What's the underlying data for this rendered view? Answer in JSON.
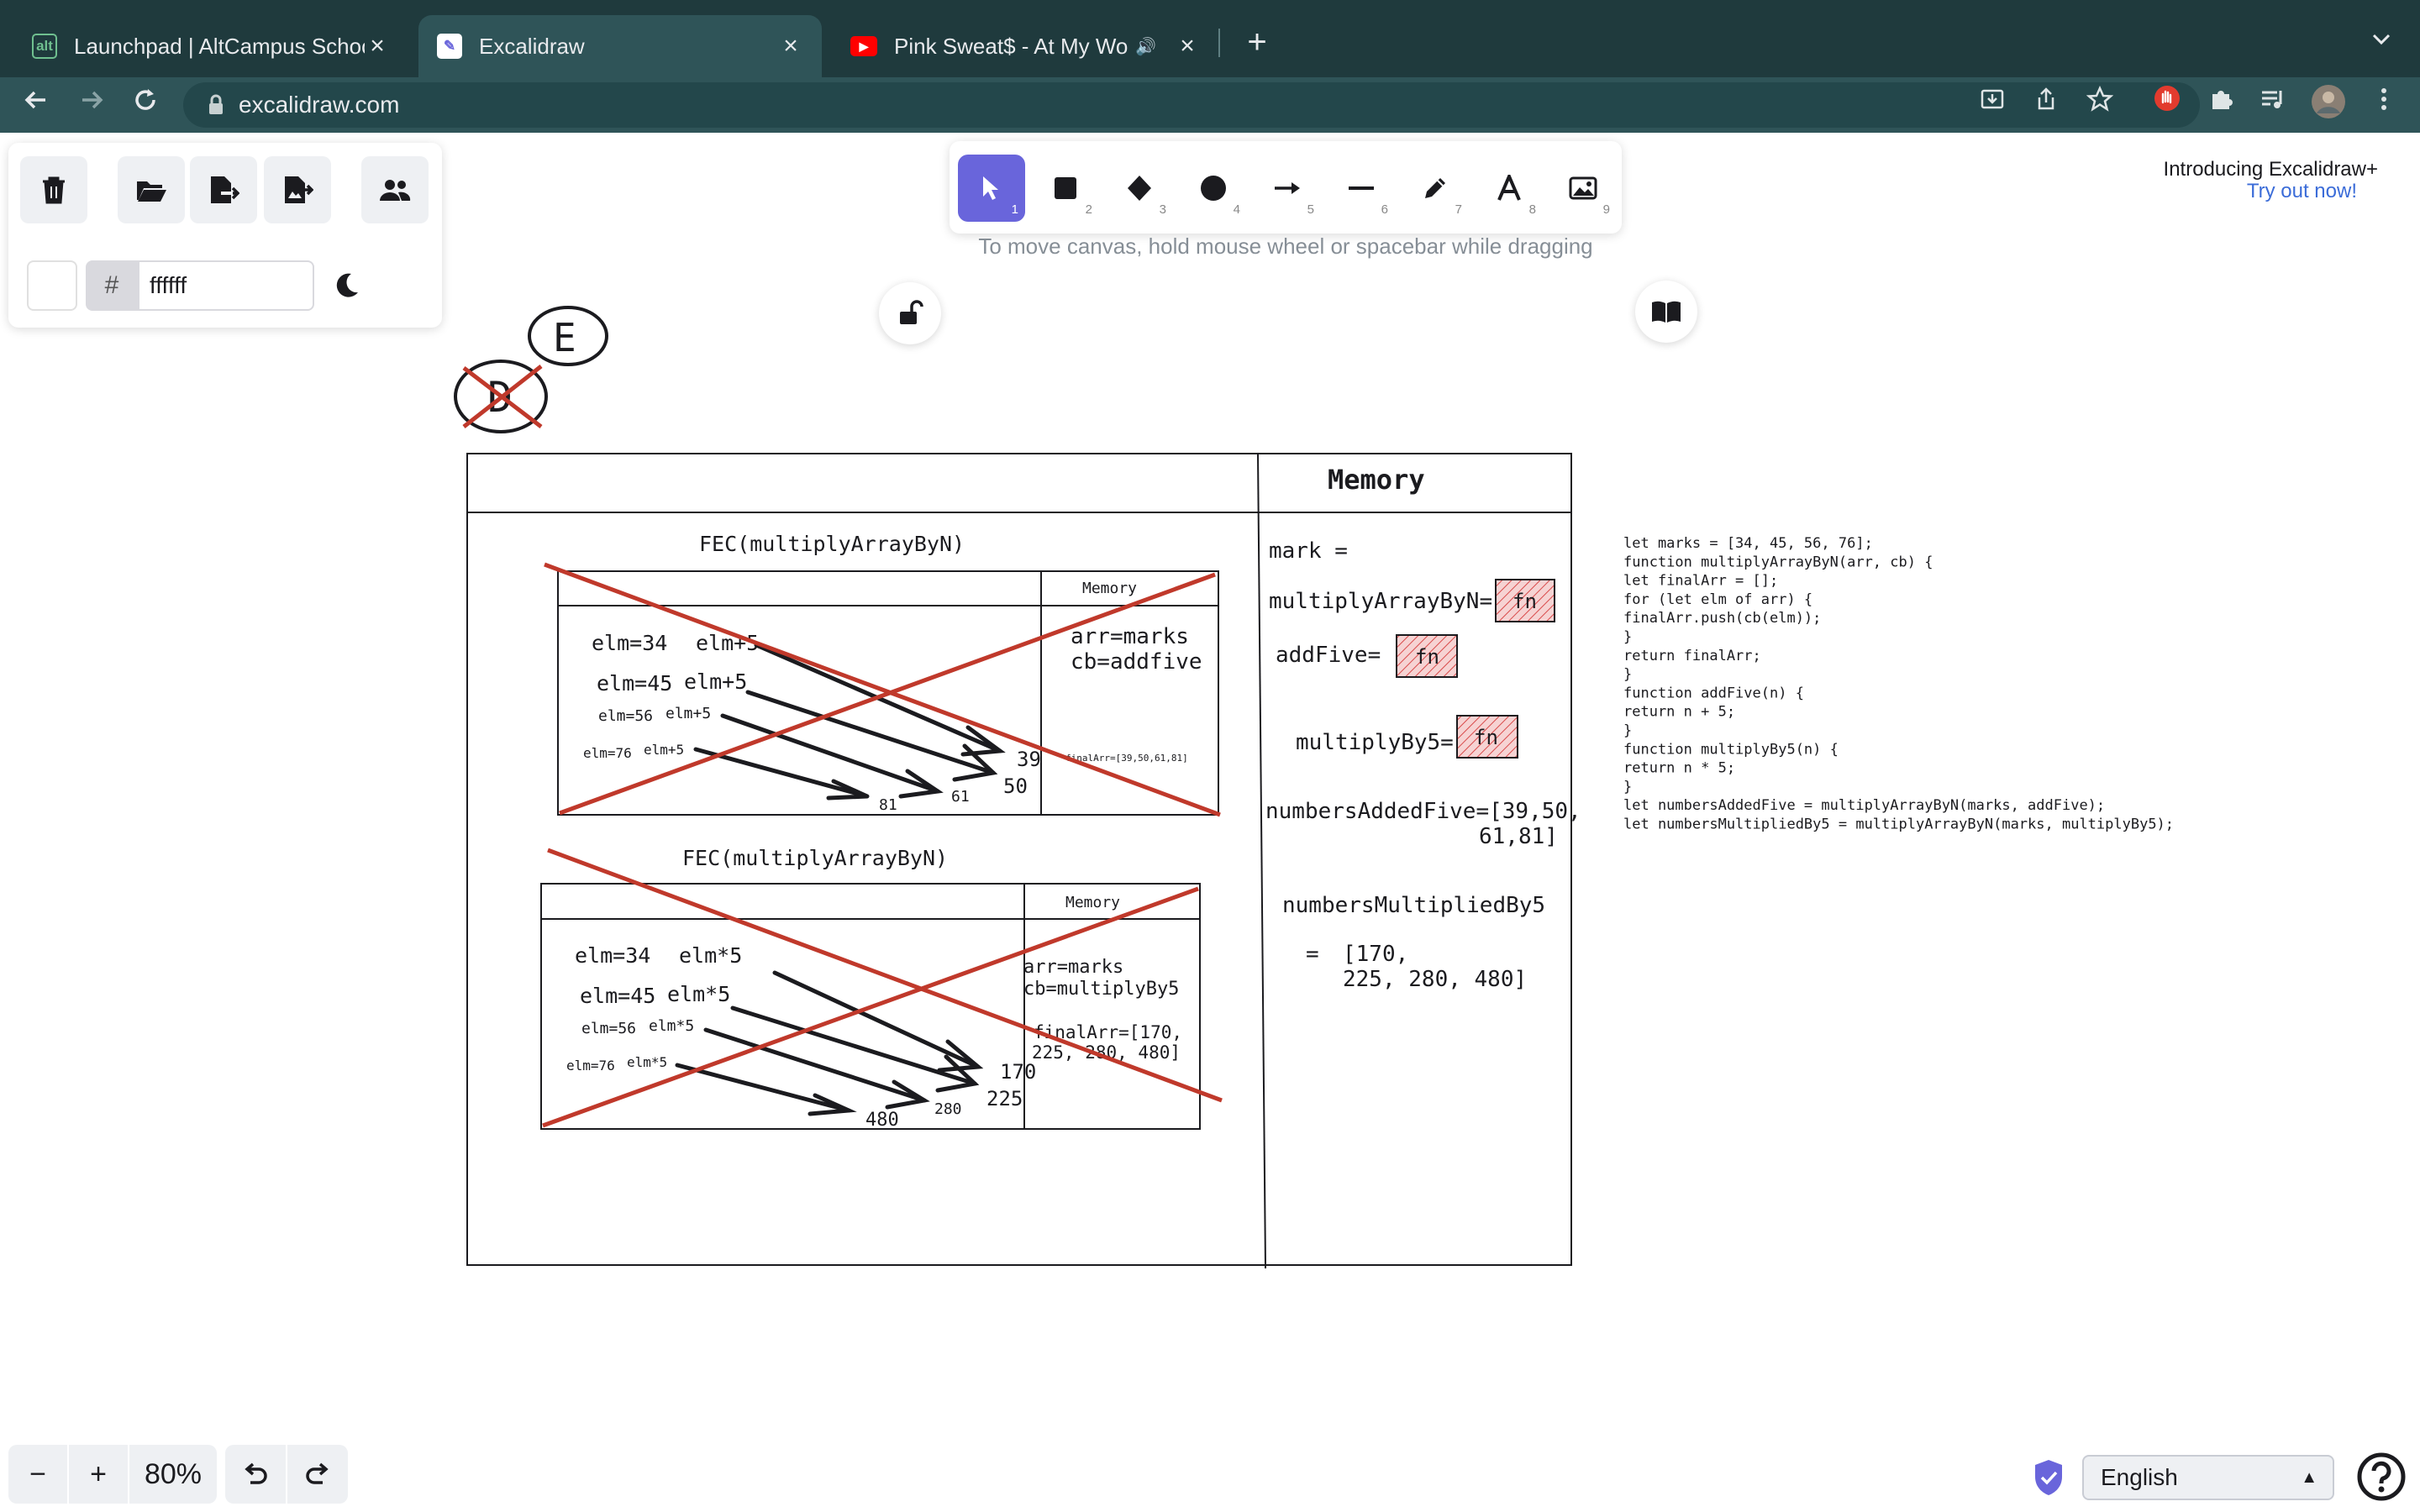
{
  "browser": {
    "tabs": [
      {
        "title": "Launchpad | AltCampus School",
        "favicon": "alt"
      },
      {
        "title": "Excalidraw",
        "favicon": "excalidraw"
      },
      {
        "title": "Pink Sweat$ - At My Worst",
        "favicon": "youtube"
      }
    ],
    "url": "excalidraw.com",
    "new_tab_label": "+",
    "tab_menu_label": "⌄"
  },
  "excalidraw": {
    "menu_buttons": [
      "clear-canvas",
      "open",
      "save-to",
      "export-image",
      "live-collaboration"
    ],
    "canvas_bg_hex": "ffffff",
    "hash_label": "#",
    "tools": [
      {
        "name": "selection",
        "key": "1"
      },
      {
        "name": "rectangle",
        "key": "2"
      },
      {
        "name": "diamond",
        "key": "3"
      },
      {
        "name": "ellipse",
        "key": "4"
      },
      {
        "name": "arrow",
        "key": "5"
      },
      {
        "name": "line",
        "key": "6"
      },
      {
        "name": "draw",
        "key": "7"
      },
      {
        "name": "text",
        "key": "8"
      },
      {
        "name": "image",
        "key": "9"
      }
    ],
    "hint": "To move canvas, hold mouse wheel or spacebar while dragging",
    "promo_title": "Introducing Excalidraw+",
    "promo_link": "Try out now!",
    "zoom_minus": "−",
    "zoom_plus": "+",
    "zoom_level": "80%",
    "language": "English"
  },
  "sketch": {
    "label_d": "D",
    "label_e": "E",
    "memory_header": "Memory",
    "fec_title_1": "FEC(multiplyArrayByN)",
    "fec_title_2": "FEC(multiplyArrayByN)",
    "inner_memory_1": "Memory",
    "inner_memory_2": "Memory",
    "fec1": {
      "elm34": "elm=34",
      "elm34_op": "elm+5",
      "elm45": "elm=45",
      "elm45_op": "elm+5",
      "elm56": "elm=56",
      "elm56_op": "elm+5",
      "elm76": "elm=76",
      "elm76_op": "elm+5",
      "out39": "39",
      "out50": "50",
      "out61": "61",
      "out81": "81",
      "mem_arr": "arr=marks",
      "mem_cb": "cb=addfive",
      "mem_final": "finalArr=[39,50,61,81]"
    },
    "fec2": {
      "elm34": "elm=34",
      "elm34_op": "elm*5",
      "elm45": "elm=45",
      "elm45_op": "elm*5",
      "elm56": "elm=56",
      "elm56_op": "elm*5",
      "elm76": "elm=76",
      "elm76_op": "elm*5",
      "out170": "170",
      "out225": "225",
      "out280": "280",
      "out480": "480",
      "mem_arr": "arr=marks",
      "mem_cb": "cb=multiplyBy5",
      "mem_final_1": "finalArr=[170,",
      "mem_final_2": "225, 280, 480]"
    },
    "global_memory": {
      "mark": "mark =",
      "multiplyArrayByN": "multiplyArrayByN=",
      "addFive": "addFive=",
      "multiplyBy5": "multiplyBy5=",
      "fn": "fn",
      "numbersAddedFive_1": "numbersAddedFive=[39,50,",
      "numbersAddedFive_2": "61,81]",
      "numbersMultipliedBy5": "numbersMultipliedBy5",
      "nm_eq": "=",
      "nm_val_1": "[170,",
      "nm_val_2": "225, 280, 480]"
    },
    "code_lines": [
      "let marks = [34, 45, 56, 76];",
      "function multiplyArrayByN(arr, cb) {",
      "  let finalArr = [];",
      "  for (let elm of arr) {",
      "    finalArr.push(cb(elm));",
      "  }",
      "  return finalArr;",
      "}",
      "function addFive(n) {",
      "  return n + 5;",
      "}",
      "function multiplyBy5(n) {",
      "  return n * 5;",
      "}",
      "let numbersAddedFive = multiplyArrayByN(marks, addFive);",
      "let numbersMultipliedBy5 = multiplyArrayByN(marks, multiplyBy5);"
    ],
    "colors": {
      "cross": "#c0392b",
      "ink": "#1b1b1f",
      "fn_fill": "#f3c1c1",
      "fn_hatch": "#d94a4a"
    }
  }
}
